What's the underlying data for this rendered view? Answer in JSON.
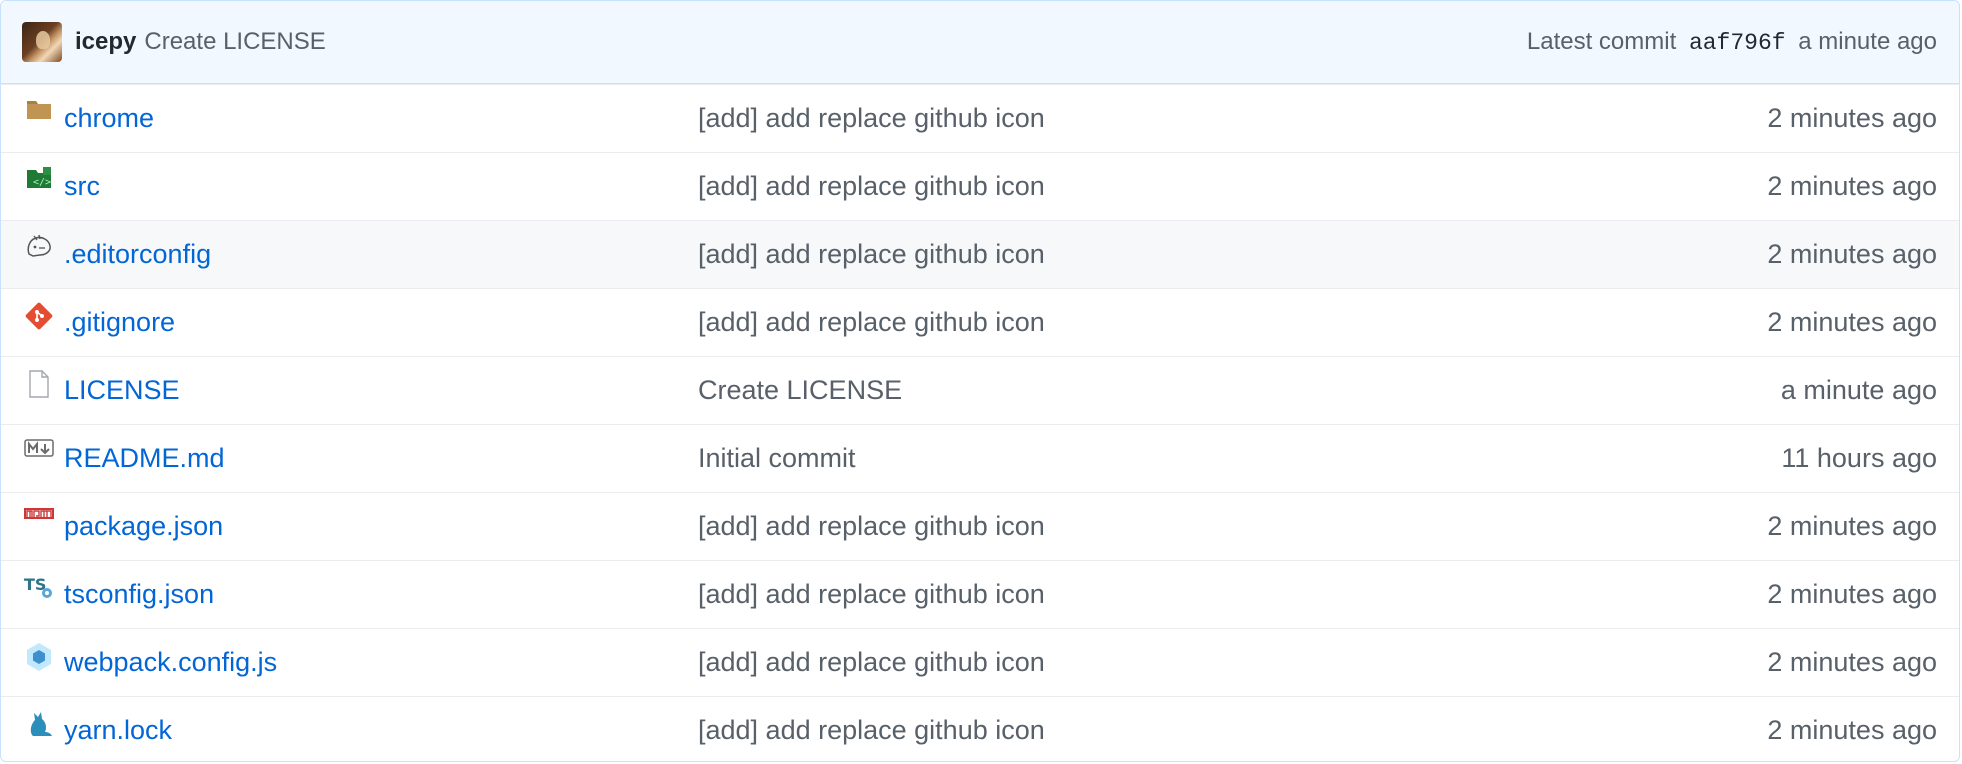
{
  "latest_commit": {
    "author": "icepy",
    "message": "Create LICENSE",
    "label": "Latest commit",
    "sha": "aaf796f",
    "time": "a minute ago"
  },
  "files": [
    {
      "name": "chrome",
      "icon": "folder-icon",
      "message": "[add] add replace github icon",
      "age": "2 minutes ago"
    },
    {
      "name": "src",
      "icon": "folder-src-icon",
      "message": "[add] add replace github icon",
      "age": "2 minutes ago"
    },
    {
      "name": ".editorconfig",
      "icon": "editorconfig-icon",
      "message": "[add] add replace github icon",
      "age": "2 minutes ago"
    },
    {
      "name": ".gitignore",
      "icon": "git-icon",
      "message": "[add] add replace github icon",
      "age": "2 minutes ago"
    },
    {
      "name": "LICENSE",
      "icon": "file-icon",
      "message": "Create LICENSE",
      "age": "a minute ago"
    },
    {
      "name": "README.md",
      "icon": "markdown-icon",
      "message": "Initial commit",
      "age": "11 hours ago"
    },
    {
      "name": "package.json",
      "icon": "npm-icon",
      "message": "[add] add replace github icon",
      "age": "2 minutes ago"
    },
    {
      "name": "tsconfig.json",
      "icon": "typescript-config-icon",
      "message": "[add] add replace github icon",
      "age": "2 minutes ago"
    },
    {
      "name": "webpack.config.js",
      "icon": "webpack-icon",
      "message": "[add] add replace github icon",
      "age": "2 minutes ago"
    },
    {
      "name": "yarn.lock",
      "icon": "yarn-icon",
      "message": "[add] add replace github icon",
      "age": "2 minutes ago"
    }
  ],
  "colors": {
    "link": "#0366d6",
    "muted": "#586069",
    "commit_bar_bg": "#f1f8ff",
    "hover_row_bg": "#f6f8fa"
  }
}
